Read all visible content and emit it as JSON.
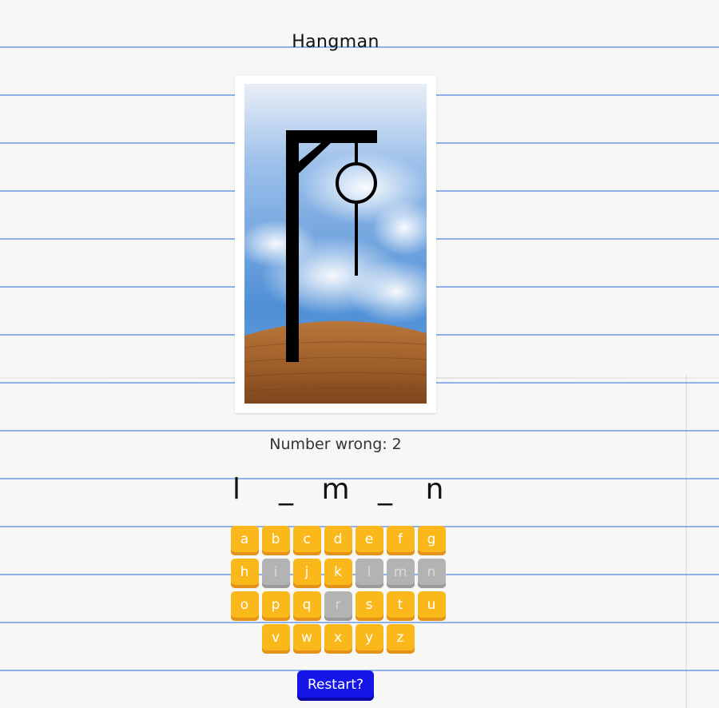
{
  "title": "Hangman",
  "status": {
    "wrong_label": "Number wrong:",
    "wrong_count": "2"
  },
  "word": [
    "l",
    "_",
    "m",
    "_",
    "n"
  ],
  "keyboard": {
    "rows": [
      [
        {
          "letter": "a",
          "used": false
        },
        {
          "letter": "b",
          "used": false
        },
        {
          "letter": "c",
          "used": false
        },
        {
          "letter": "d",
          "used": false
        },
        {
          "letter": "e",
          "used": false
        },
        {
          "letter": "f",
          "used": false
        },
        {
          "letter": "g",
          "used": false
        }
      ],
      [
        {
          "letter": "h",
          "used": false
        },
        {
          "letter": "i",
          "used": true
        },
        {
          "letter": "j",
          "used": false
        },
        {
          "letter": "k",
          "used": false
        },
        {
          "letter": "l",
          "used": true
        },
        {
          "letter": "m",
          "used": true
        },
        {
          "letter": "n",
          "used": true
        }
      ],
      [
        {
          "letter": "o",
          "used": false
        },
        {
          "letter": "p",
          "used": false
        },
        {
          "letter": "q",
          "used": false
        },
        {
          "letter": "r",
          "used": true
        },
        {
          "letter": "s",
          "used": false
        },
        {
          "letter": "t",
          "used": false
        },
        {
          "letter": "u",
          "used": false
        }
      ],
      [
        {
          "letter": "v",
          "used": false
        },
        {
          "letter": "w",
          "used": false
        },
        {
          "letter": "x",
          "used": false
        },
        {
          "letter": "y",
          "used": false
        },
        {
          "letter": "z",
          "used": false
        }
      ]
    ]
  },
  "restart_label": "Restart?",
  "colors": {
    "key": "#fbb81b",
    "key_used": "#b3b3b3",
    "restart": "#1515e8",
    "sky": "#4f8fd6",
    "ground": "#a0602a"
  }
}
